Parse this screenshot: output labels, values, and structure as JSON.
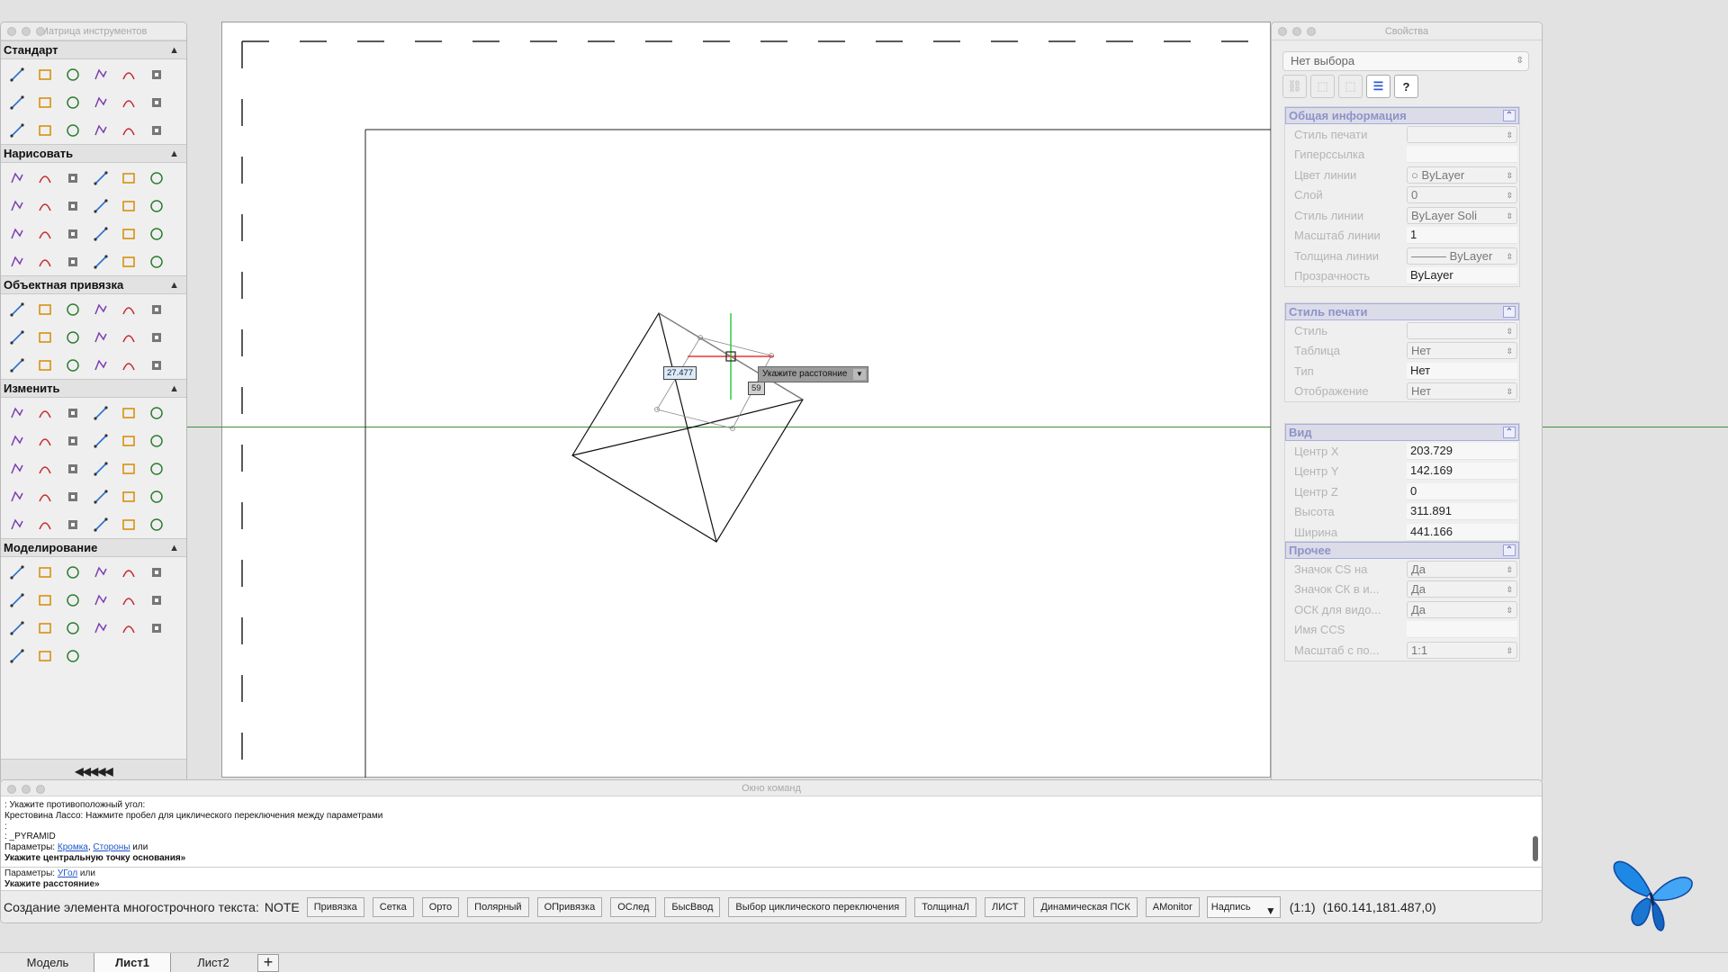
{
  "tool_palette": {
    "title": "Матрица инструментов",
    "sections": [
      {
        "label": "Стандарт",
        "icons": [
          "new-file-icon",
          "open-folder-icon",
          "save-icon",
          "print-icon",
          "plot-icon",
          "print-preview-icon",
          "publish-icon",
          "cut-icon",
          "copy-icon",
          "paste-icon",
          "match-properties-icon",
          "undo-icon",
          "redo-icon",
          "pan-icon",
          "zoom-window-icon",
          "zoom-realtime-icon",
          "layers-icon",
          "properties-icon"
        ]
      },
      {
        "label": "Нарисовать",
        "icons": [
          "line-icon",
          "polyline-icon",
          "circle-icon",
          "rectangle-icon",
          "arc-icon",
          "spline-icon",
          "donut-icon",
          "spiral-icon",
          "cloud-icon",
          "points-icon",
          "freehand-icon",
          "sketch-icon",
          "ray-icon",
          "xline-icon",
          "hatch-icon",
          "gradient-icon",
          "region-icon",
          "text-icon",
          "table-icon",
          "boundary-icon",
          "wipeout-icon",
          "ellipse-icon",
          "revcloud-icon",
          "block-icon"
        ]
      },
      {
        "label": "Объектная привязка",
        "icons": [
          "snap-endpoint-icon",
          "snap-midpoint-icon",
          "snap-intersection-icon",
          "snap-apparent-icon",
          "snap-extension-icon",
          "snap-perpendicular-icon",
          "snap-tangent-icon",
          "snap-center-icon",
          "snap-node-icon",
          "snap-quadrant-icon",
          "snap-nearest-icon",
          "snap-insert-icon",
          "snap-parallel-icon",
          "snap-parallel-line-icon",
          "snap-none-icon",
          "snap-temp-track-icon",
          "snap-off-icon",
          "snap-settings-icon"
        ]
      },
      {
        "label": "Изменить",
        "icons": [
          "erase-icon",
          "copy-object-icon",
          "move-icon",
          "scale-icon",
          "mirror-icon",
          "offset-icon",
          "fillet-icon",
          "array-icon",
          "rotate-icon",
          "stretch-icon",
          "trim-icon",
          "extend-icon",
          "break-icon",
          "break-at-point-icon",
          "chamfer-icon",
          "join-icon",
          "explode-icon",
          "lengthen-icon",
          "align-icon",
          "divide-icon",
          "measure-icon",
          "edit-polyline-icon",
          "edit-spline-icon",
          "edit-hatch-icon",
          "attribute-edit-icon",
          "block-edit-icon",
          "draworder-icon",
          "selection-icon",
          "group-icon",
          "ungroup-icon"
        ]
      },
      {
        "label": "Моделирование",
        "icons": [
          "box-icon",
          "cone-icon",
          "cylinder-icon",
          "pyramid-icon",
          "sphere-icon",
          "torus-icon",
          "wedge-icon",
          "planar-surface-icon",
          "extrude-icon",
          "revolve-icon",
          "sweep-icon",
          "loft-icon",
          "presspull-icon",
          "helix-icon",
          "union-icon",
          "subtract-icon",
          "intersect-icon",
          "solid-edit-icon",
          "section-plane-icon",
          "flatshot-icon",
          "render-icon"
        ]
      }
    ],
    "collapse_label": "◀◀◀◀◀"
  },
  "properties": {
    "title": "Свойства",
    "selection": "Нет выбора",
    "tool_buttons": [
      "toggle-pickadd-icon",
      "select-objects-icon",
      "quick-select-icon",
      "properties-filter-icon",
      "help-icon"
    ],
    "help_label": "?",
    "sections": [
      {
        "title": "Общая информация",
        "rows": [
          {
            "label": "Стиль печати",
            "value": "",
            "kind": "dd"
          },
          {
            "label": "Гиперссылка",
            "value": "",
            "kind": "fld"
          },
          {
            "label": "Цвет линии",
            "value": "○  ByLayer",
            "kind": "dd"
          },
          {
            "label": "Слой",
            "value": "0",
            "kind": "dd"
          },
          {
            "label": "Стиль линии",
            "value": "ByLayer    Soli",
            "kind": "dd"
          },
          {
            "label": "Масштаб линии",
            "value": "1",
            "kind": "fld"
          },
          {
            "label": "Толщина линии",
            "value": "——— ByLayer",
            "kind": "dd"
          },
          {
            "label": "Прозрачность",
            "value": "ByLayer",
            "kind": "fld"
          }
        ]
      },
      {
        "title": "Стиль печати",
        "rows": [
          {
            "label": "Стиль",
            "value": "",
            "kind": "dd"
          },
          {
            "label": "Таблица",
            "value": "Нет",
            "kind": "dd"
          },
          {
            "label": "Тип",
            "value": "Нет",
            "kind": "fld"
          },
          {
            "label": "Отображение",
            "value": "Нет",
            "kind": "dd"
          }
        ]
      },
      {
        "title": "Вид",
        "rows": [
          {
            "label": "Центр X",
            "value": "203.729",
            "kind": "fld"
          },
          {
            "label": "Центр Y",
            "value": "142.169",
            "kind": "fld"
          },
          {
            "label": "Центр Z",
            "value": "0",
            "kind": "fld"
          },
          {
            "label": "Высота",
            "value": "311.891",
            "kind": "fld"
          },
          {
            "label": "Ширина",
            "value": "441.166",
            "kind": "fld"
          }
        ]
      },
      {
        "title": "Прочее",
        "rows": [
          {
            "label": "Значок CS на",
            "value": "Да",
            "kind": "dd"
          },
          {
            "label": "Значок СК в и...",
            "value": "Да",
            "kind": "dd"
          },
          {
            "label": "ОСК для видо...",
            "value": "Да",
            "kind": "dd"
          },
          {
            "label": "Имя CCS",
            "value": "",
            "kind": "fld"
          },
          {
            "label": "Масштаб с по...",
            "value": "1:1",
            "kind": "dd"
          }
        ]
      }
    ]
  },
  "drawing": {
    "dim_length": "27.477",
    "dim_angle": "59",
    "prompt_tooltip": "Укажите расстояние"
  },
  "command": {
    "title": "Окно команд",
    "history": [
      ": Укажите противоположный угол:",
      "Крестовина Лассо: Нажмите пробел для циклического переключения между параметрами",
      ":",
      ": _PYRAMID"
    ],
    "params_prefix": "Параметры: ",
    "param_edge": "Кромка",
    "param_sep": ", ",
    "param_sides": "Стороны",
    "params_suffix": " или",
    "history_bold": "Укажите центральную точку основания»",
    "current_prefix": "Параметры: ",
    "current_param": "УГол",
    "current_suffix": " или",
    "current_prompt": "Укажите расстояние»"
  },
  "status": {
    "mode_text": "Создание элемента многострочного текста:",
    "note": "NOTE",
    "buttons": [
      "Привязка",
      "Сетка",
      "Орто",
      "Полярный",
      "ОПривязка",
      "ОСлед",
      "БысВвод",
      "Выбор циклического переключения",
      "ТолщинаЛ",
      "ЛИСТ",
      "Динамическая ПСК",
      "AMonitor"
    ],
    "annotation_select": "Надпись",
    "scale": "(1:1)",
    "coords": "(160.141,181.487,0)"
  },
  "tabs": [
    "Модель",
    "Лист1",
    "Лист2"
  ],
  "active_tab": "Лист1",
  "add_tab_label": "+",
  "colors": {
    "crosshair": "#3d8c3d",
    "cursor_red": "#e53935",
    "cursor_green": "#2ecc40",
    "butterfly": "#1e88e5",
    "link": "#1d56c9"
  }
}
